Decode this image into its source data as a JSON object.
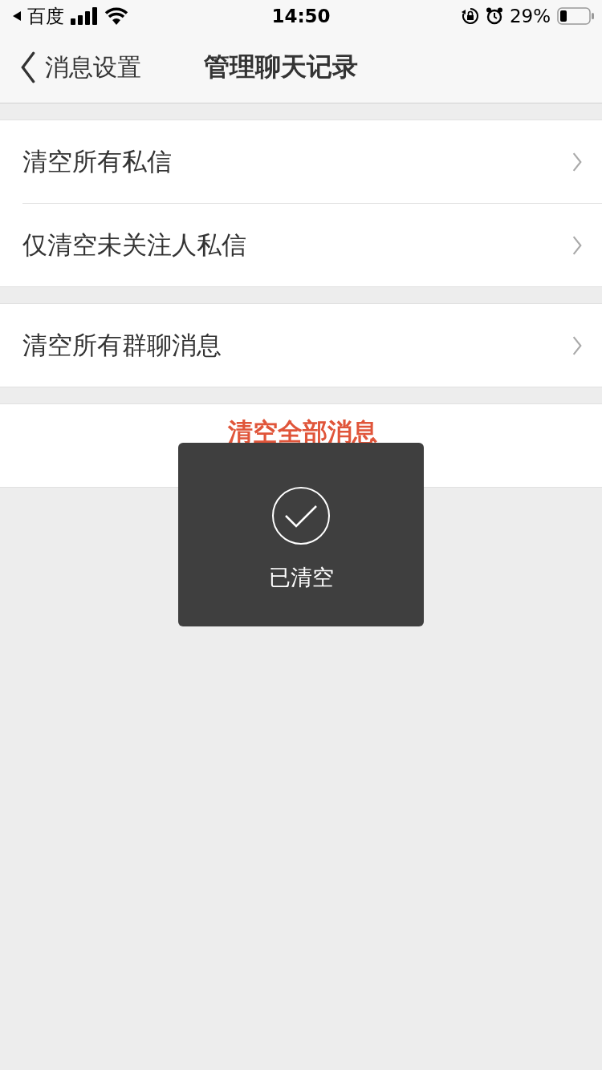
{
  "status_bar": {
    "back_app": "百度",
    "time": "14:50",
    "battery": "29%"
  },
  "nav": {
    "back_label": "消息设置",
    "title": "管理聊天记录"
  },
  "groups": [
    {
      "items": [
        {
          "label": "清空所有私信",
          "kind": "link"
        },
        {
          "label": "仅清空未关注人私信",
          "kind": "link"
        }
      ]
    },
    {
      "items": [
        {
          "label": "清空所有群聊消息",
          "kind": "link"
        }
      ]
    },
    {
      "items": [
        {
          "label": "清空全部消息",
          "kind": "danger"
        }
      ]
    }
  ],
  "toast": {
    "text": "已清空"
  }
}
